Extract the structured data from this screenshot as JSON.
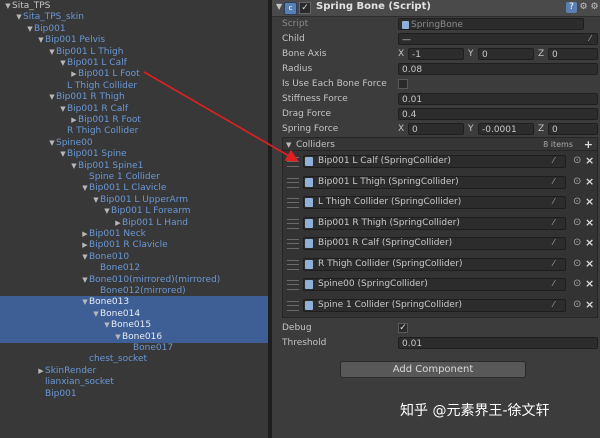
{
  "hierarchy": {
    "rows": [
      {
        "label": "Sita_TPS",
        "depth": 0,
        "expanded": true,
        "hasChildren": true,
        "kind": "plain"
      },
      {
        "label": "Sita_TPS_skin",
        "depth": 1,
        "expanded": true,
        "hasChildren": true,
        "kind": "prefab"
      },
      {
        "label": "Bip001",
        "depth": 2,
        "expanded": true,
        "hasChildren": true,
        "kind": "prefab"
      },
      {
        "label": "Bip001 Pelvis",
        "depth": 3,
        "expanded": true,
        "hasChildren": true,
        "kind": "prefab"
      },
      {
        "label": "Bip001 L Thigh",
        "depth": 4,
        "expanded": true,
        "hasChildren": true,
        "kind": "prefab"
      },
      {
        "label": "Bip001 L Calf",
        "depth": 5,
        "expanded": true,
        "hasChildren": true,
        "kind": "prefab"
      },
      {
        "label": "Bip001 L Foot",
        "depth": 6,
        "expanded": false,
        "hasChildren": true,
        "kind": "prefab"
      },
      {
        "label": "L Thigh Collider",
        "depth": 5,
        "expanded": false,
        "hasChildren": false,
        "kind": "prefab"
      },
      {
        "label": "Bip001 R Thigh",
        "depth": 4,
        "expanded": true,
        "hasChildren": true,
        "kind": "prefab"
      },
      {
        "label": "Bip001 R Calf",
        "depth": 5,
        "expanded": true,
        "hasChildren": true,
        "kind": "prefab"
      },
      {
        "label": "Bip001 R Foot",
        "depth": 6,
        "expanded": false,
        "hasChildren": true,
        "kind": "prefab"
      },
      {
        "label": "R Thigh Collider",
        "depth": 5,
        "expanded": false,
        "hasChildren": false,
        "kind": "prefab"
      },
      {
        "label": "Spine00",
        "depth": 4,
        "expanded": true,
        "hasChildren": true,
        "kind": "prefab"
      },
      {
        "label": "Bip001 Spine",
        "depth": 5,
        "expanded": true,
        "hasChildren": true,
        "kind": "prefab"
      },
      {
        "label": "Bip001 Spine1",
        "depth": 6,
        "expanded": true,
        "hasChildren": true,
        "kind": "prefab"
      },
      {
        "label": "Spine 1 Collider",
        "depth": 7,
        "expanded": false,
        "hasChildren": false,
        "kind": "prefab"
      },
      {
        "label": "Bip001 L Clavicle",
        "depth": 7,
        "expanded": true,
        "hasChildren": true,
        "kind": "prefab"
      },
      {
        "label": "Bip001 L UpperArm",
        "depth": 8,
        "expanded": true,
        "hasChildren": true,
        "kind": "prefab"
      },
      {
        "label": "Bip001 L Forearm",
        "depth": 9,
        "expanded": true,
        "hasChildren": true,
        "kind": "prefab"
      },
      {
        "label": "Bip001 L Hand",
        "depth": 10,
        "expanded": false,
        "hasChildren": true,
        "kind": "prefab"
      },
      {
        "label": "Bip001 Neck",
        "depth": 7,
        "expanded": false,
        "hasChildren": true,
        "kind": "prefab"
      },
      {
        "label": "Bip001 R Clavicle",
        "depth": 7,
        "expanded": false,
        "hasChildren": true,
        "kind": "prefab"
      },
      {
        "label": "Bone010",
        "depth": 7,
        "expanded": true,
        "hasChildren": true,
        "kind": "prefab"
      },
      {
        "label": "Bone012",
        "depth": 8,
        "expanded": false,
        "hasChildren": false,
        "kind": "prefab"
      },
      {
        "label": "Bone010(mirrored)(mirrored)",
        "depth": 7,
        "expanded": true,
        "hasChildren": true,
        "kind": "prefab"
      },
      {
        "label": "Bone012(mirrored)",
        "depth": 8,
        "expanded": false,
        "hasChildren": false,
        "kind": "prefab"
      },
      {
        "label": "Bone013",
        "depth": 7,
        "expanded": true,
        "hasChildren": true,
        "kind": "prefab",
        "selected": true
      },
      {
        "label": "Bone014",
        "depth": 8,
        "expanded": true,
        "hasChildren": true,
        "kind": "prefab",
        "selected": true
      },
      {
        "label": "Bone015",
        "depth": 9,
        "expanded": true,
        "hasChildren": true,
        "kind": "prefab",
        "selected": true
      },
      {
        "label": "Bone016",
        "depth": 10,
        "expanded": true,
        "hasChildren": true,
        "kind": "prefab",
        "selected": true
      },
      {
        "label": "Bone017",
        "depth": 11,
        "expanded": false,
        "hasChildren": false,
        "kind": "prefab"
      },
      {
        "label": "chest_socket",
        "depth": 7,
        "expanded": false,
        "hasChildren": false,
        "kind": "prefab"
      },
      {
        "label": "SkinRender",
        "depth": 3,
        "expanded": false,
        "hasChildren": true,
        "kind": "prefab"
      },
      {
        "label": "lianxian_socket",
        "depth": 3,
        "expanded": false,
        "hasChildren": false,
        "kind": "prefab"
      },
      {
        "label": "Bip001",
        "depth": 3,
        "expanded": false,
        "hasChildren": false,
        "kind": "prefab"
      }
    ]
  },
  "component": {
    "title": "Spring Bone (Script)",
    "script_label": "Script",
    "script_value": "SpringBone",
    "child_label": "Child",
    "child_value": "—",
    "bone_axis_label": "Bone Axis",
    "bone_axis": {
      "x": "-1",
      "y": "0",
      "z": "0"
    },
    "radius_label": "Radius",
    "radius_value": "0.08",
    "use_each_label": "Is Use Each Bone Force",
    "use_each_checked": "",
    "stiffness_label": "Stiffness Force",
    "stiffness_value": "0.01",
    "drag_label": "Drag Force",
    "drag_value": "0.4",
    "spring_label": "Spring Force",
    "spring_force": {
      "x": "0",
      "y": "-0.0001",
      "z": "0"
    },
    "axis_x": "X",
    "axis_y": "Y",
    "axis_z": "Z",
    "colliders_label": "Colliders",
    "colliders_count": "8 items",
    "colliders": [
      "Bip001 L Calf (SpringCollider)",
      "Bip001 L Thigh (SpringCollider)",
      "L Thigh Collider (SpringCollider)",
      "Bip001 R Thigh (SpringCollider)",
      "Bip001 R Calf (SpringCollider)",
      "R Thigh Collider (SpringCollider)",
      "Spine00 (SpringCollider)",
      "Spine 1 Collider (SpringCollider)"
    ],
    "debug_label": "Debug",
    "debug_checked": "✓",
    "threshold_label": "Threshold",
    "threshold_value": "0.01"
  },
  "add_component_label": "Add Component",
  "watermark": "知乎 @元素界王-徐文轩",
  "colors": {
    "accent_selection": "#3e5f96",
    "prefab_text": "#7fa7db",
    "arrow": "#e02020"
  }
}
